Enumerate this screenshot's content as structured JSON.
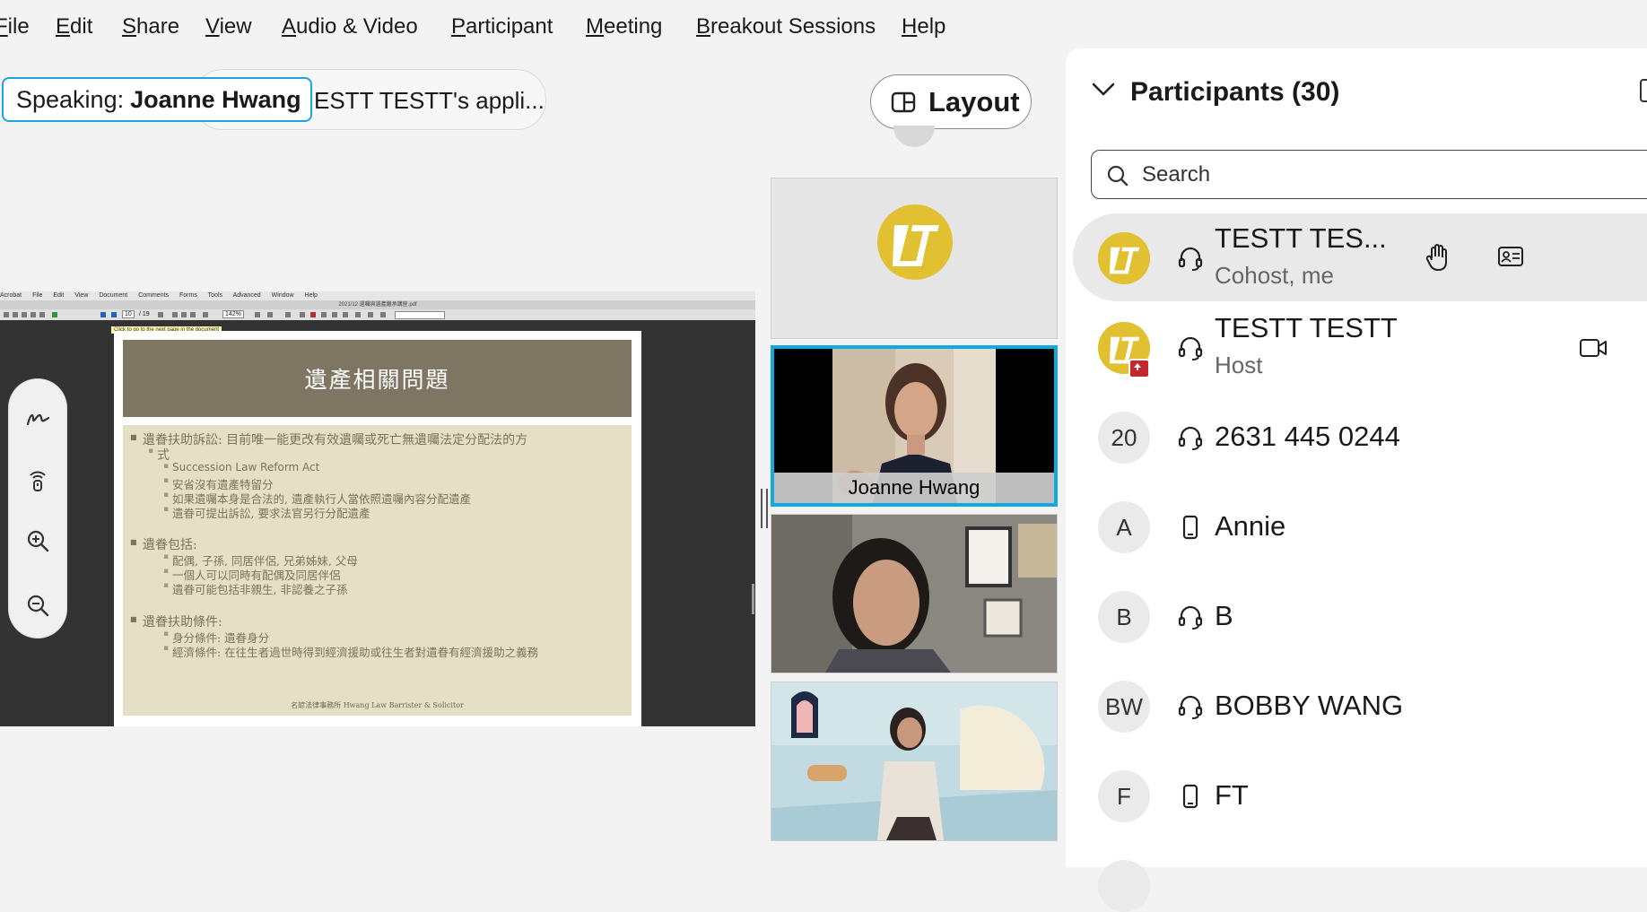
{
  "menu": {
    "items": [
      {
        "pre": "",
        "u": "F",
        "post": "ile"
      },
      {
        "pre": "",
        "u": "E",
        "post": "dit"
      },
      {
        "pre": "",
        "u": "S",
        "post": "hare"
      },
      {
        "pre": "",
        "u": "V",
        "post": "iew"
      },
      {
        "pre": "",
        "u": "A",
        "post": "udio & Video"
      },
      {
        "pre": "",
        "u": "P",
        "post": "articipant"
      },
      {
        "pre": "",
        "u": "M",
        "post": "eeting"
      },
      {
        "pre": "",
        "u": "B",
        "post": "reakout Sessions"
      },
      {
        "pre": "",
        "u": "H",
        "post": "elp"
      }
    ]
  },
  "sharing": {
    "label": "ESTT TESTT's appli..."
  },
  "speaking": {
    "prefix": "Speaking:",
    "name": "Joanne Hwang"
  },
  "layout_button": {
    "label": "Layout"
  },
  "shared_screen": {
    "acrobat_menu": [
      "Acrobat",
      "File",
      "Edit",
      "View",
      "Document",
      "Comments",
      "Forms",
      "Tools",
      "Advanced",
      "Window",
      "Help"
    ],
    "window_title": "2021/12 遺囑與遺產繼承講座.pdf",
    "page_input": "10",
    "page_total": "/ 19",
    "zoom": "142%",
    "tooltip": "Click to go to the next page in the document",
    "slide": {
      "title": "遺產相關問題",
      "bullets": [
        {
          "text": "遺眷扶助訴訟: 目前唯一能更改有效遺囑或死亡無遺囑法定分配法的方",
          "cont": "式",
          "subs": [
            "Succession Law Reform Act",
            "安省沒有遺產特留分",
            "如果遺囑本身是合法的, 遺產執行人當依照遺囑內容分配遺產",
            "遺眷可提出訴訟, 要求法官另行分配遺產"
          ]
        },
        {
          "text": "遺眷包括:",
          "cont": "",
          "subs": [
            "配偶, 子孫, 同居伴侶, 兄弟姊妹, 父母",
            "一個人可以同時有配偶及同居伴侶",
            "遺眷可能包括非親生, 非認養之子孫"
          ]
        },
        {
          "text": "遺眷扶助條件:",
          "cont": "",
          "subs": [
            "身分條件: 遺眷身分",
            "經濟條件: 在往生者過世時得到經濟援助或往生者對遺眷有經濟援助之義務"
          ]
        }
      ],
      "footer": "名諺法律事務所 Hwang Law Barrister & Solicitor"
    }
  },
  "video_tiles": [
    {
      "name": "",
      "kind": "avatar"
    },
    {
      "name": "Joanne Hwang",
      "kind": "video",
      "active": true
    },
    {
      "name": "",
      "kind": "video"
    },
    {
      "name": "",
      "kind": "video"
    }
  ],
  "participants_panel": {
    "title": "Participants (30)",
    "search_placeholder": "Search",
    "rows": [
      {
        "initials": "",
        "avatar": "logo",
        "audio": "headset-icon",
        "name": "TESTT TES...",
        "role": "Cohost, me",
        "extra_icons": [
          "raise-hand-icon",
          "id-card-icon"
        ],
        "selected": true
      },
      {
        "initials": "",
        "avatar": "logo",
        "audio": "headset-icon",
        "name": "TESTT TESTT",
        "role": "Host",
        "extra_icons": [
          "video-camera-icon"
        ],
        "sharing_badge": true
      },
      {
        "initials": "20",
        "avatar": "text",
        "audio": "headset-icon",
        "name": "2631 445 0244",
        "role": ""
      },
      {
        "initials": "A",
        "avatar": "text",
        "audio": "phone-icon",
        "name": "Annie",
        "role": ""
      },
      {
        "initials": "B",
        "avatar": "text",
        "audio": "headset-icon",
        "name": "B",
        "role": ""
      },
      {
        "initials": "BW",
        "avatar": "text",
        "audio": "headset-icon",
        "name": "BOBBY WANG",
        "role": ""
      },
      {
        "initials": "F",
        "avatar": "text",
        "audio": "phone-icon",
        "name": "FT",
        "role": ""
      }
    ]
  },
  "colors": {
    "accent": "#12a8e0",
    "logo": "#e1c131",
    "slide_header": "#7e7563",
    "slide_body": "#e4dfc5"
  }
}
